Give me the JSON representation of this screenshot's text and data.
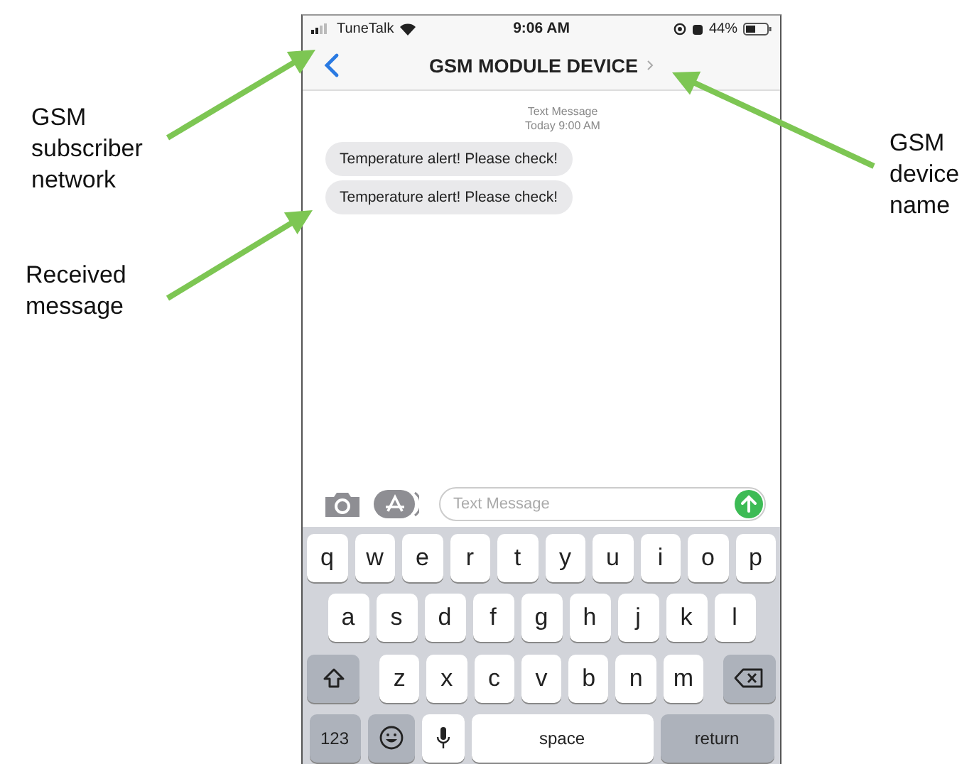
{
  "status_bar": {
    "carrier": "TuneTalk",
    "time": "9:06 AM",
    "battery": "44%"
  },
  "header": {
    "title": "GSM MODULE DEVICE"
  },
  "timestamp": {
    "label": "Text Message",
    "time": "Today 9:00 AM"
  },
  "messages": [
    {
      "text": "Temperature alert! Please check!"
    },
    {
      "text": "Temperature alert! Please check!"
    }
  ],
  "composer": {
    "placeholder": "Text Message"
  },
  "keyboard": {
    "rows": [
      [
        "q",
        "w",
        "e",
        "r",
        "t",
        "y",
        "u",
        "i",
        "o",
        "p"
      ],
      [
        "a",
        "s",
        "d",
        "f",
        "g",
        "h",
        "j",
        "k",
        "l"
      ],
      [
        "z",
        "x",
        "c",
        "v",
        "b",
        "n",
        "m"
      ]
    ],
    "numbers_key": "123",
    "space_key": "space",
    "return_key": "return"
  },
  "annotations": [
    {
      "lines": [
        "GSM",
        "subscriber",
        "network"
      ]
    },
    {
      "lines": [
        "Received",
        "message"
      ]
    },
    {
      "lines": [
        "GSM",
        "device",
        "name"
      ]
    }
  ]
}
